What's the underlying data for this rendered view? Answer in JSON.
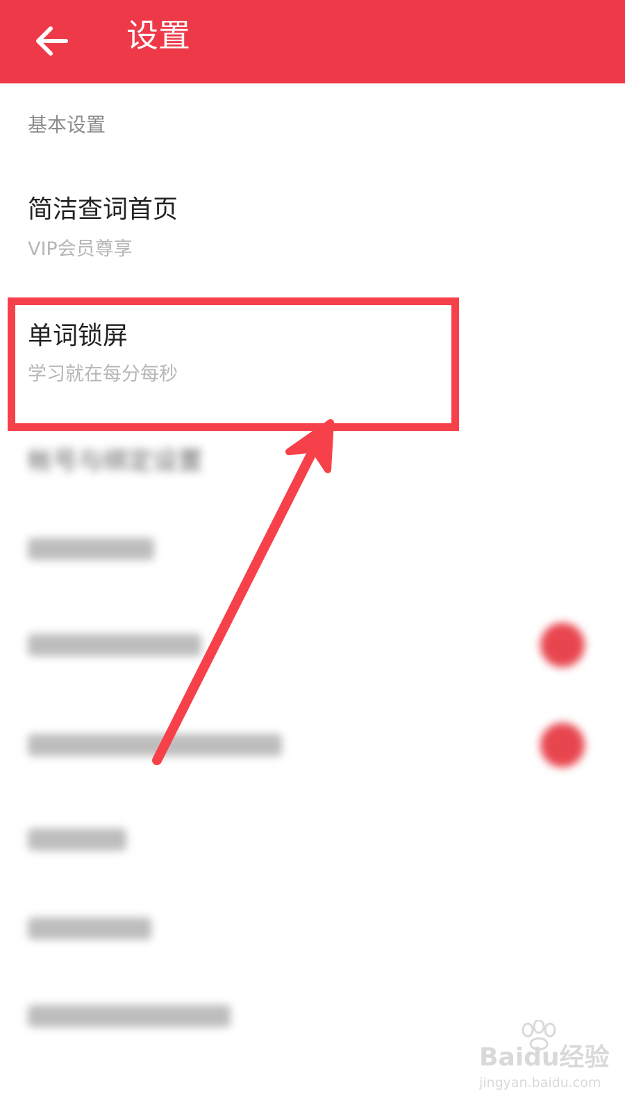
{
  "header": {
    "title": "设置",
    "back_icon": "arrow-left-icon"
  },
  "section": {
    "label": "基本设置"
  },
  "items": [
    {
      "title": "简洁查词首页",
      "subtitle": "VIP会员尊享"
    },
    {
      "title": "单词锁屏",
      "subtitle": "学习就在每分每秒"
    },
    {
      "title": "帐号与绑定设置"
    }
  ],
  "colors": {
    "header_bg": "#ee3a48",
    "highlight": "#f7414a",
    "toggle_on": "#e8464f"
  },
  "watermark": {
    "brand": "Bai",
    "brand_suffix": "du",
    "cn": "经验",
    "url": "jingyan.baidu.com"
  }
}
